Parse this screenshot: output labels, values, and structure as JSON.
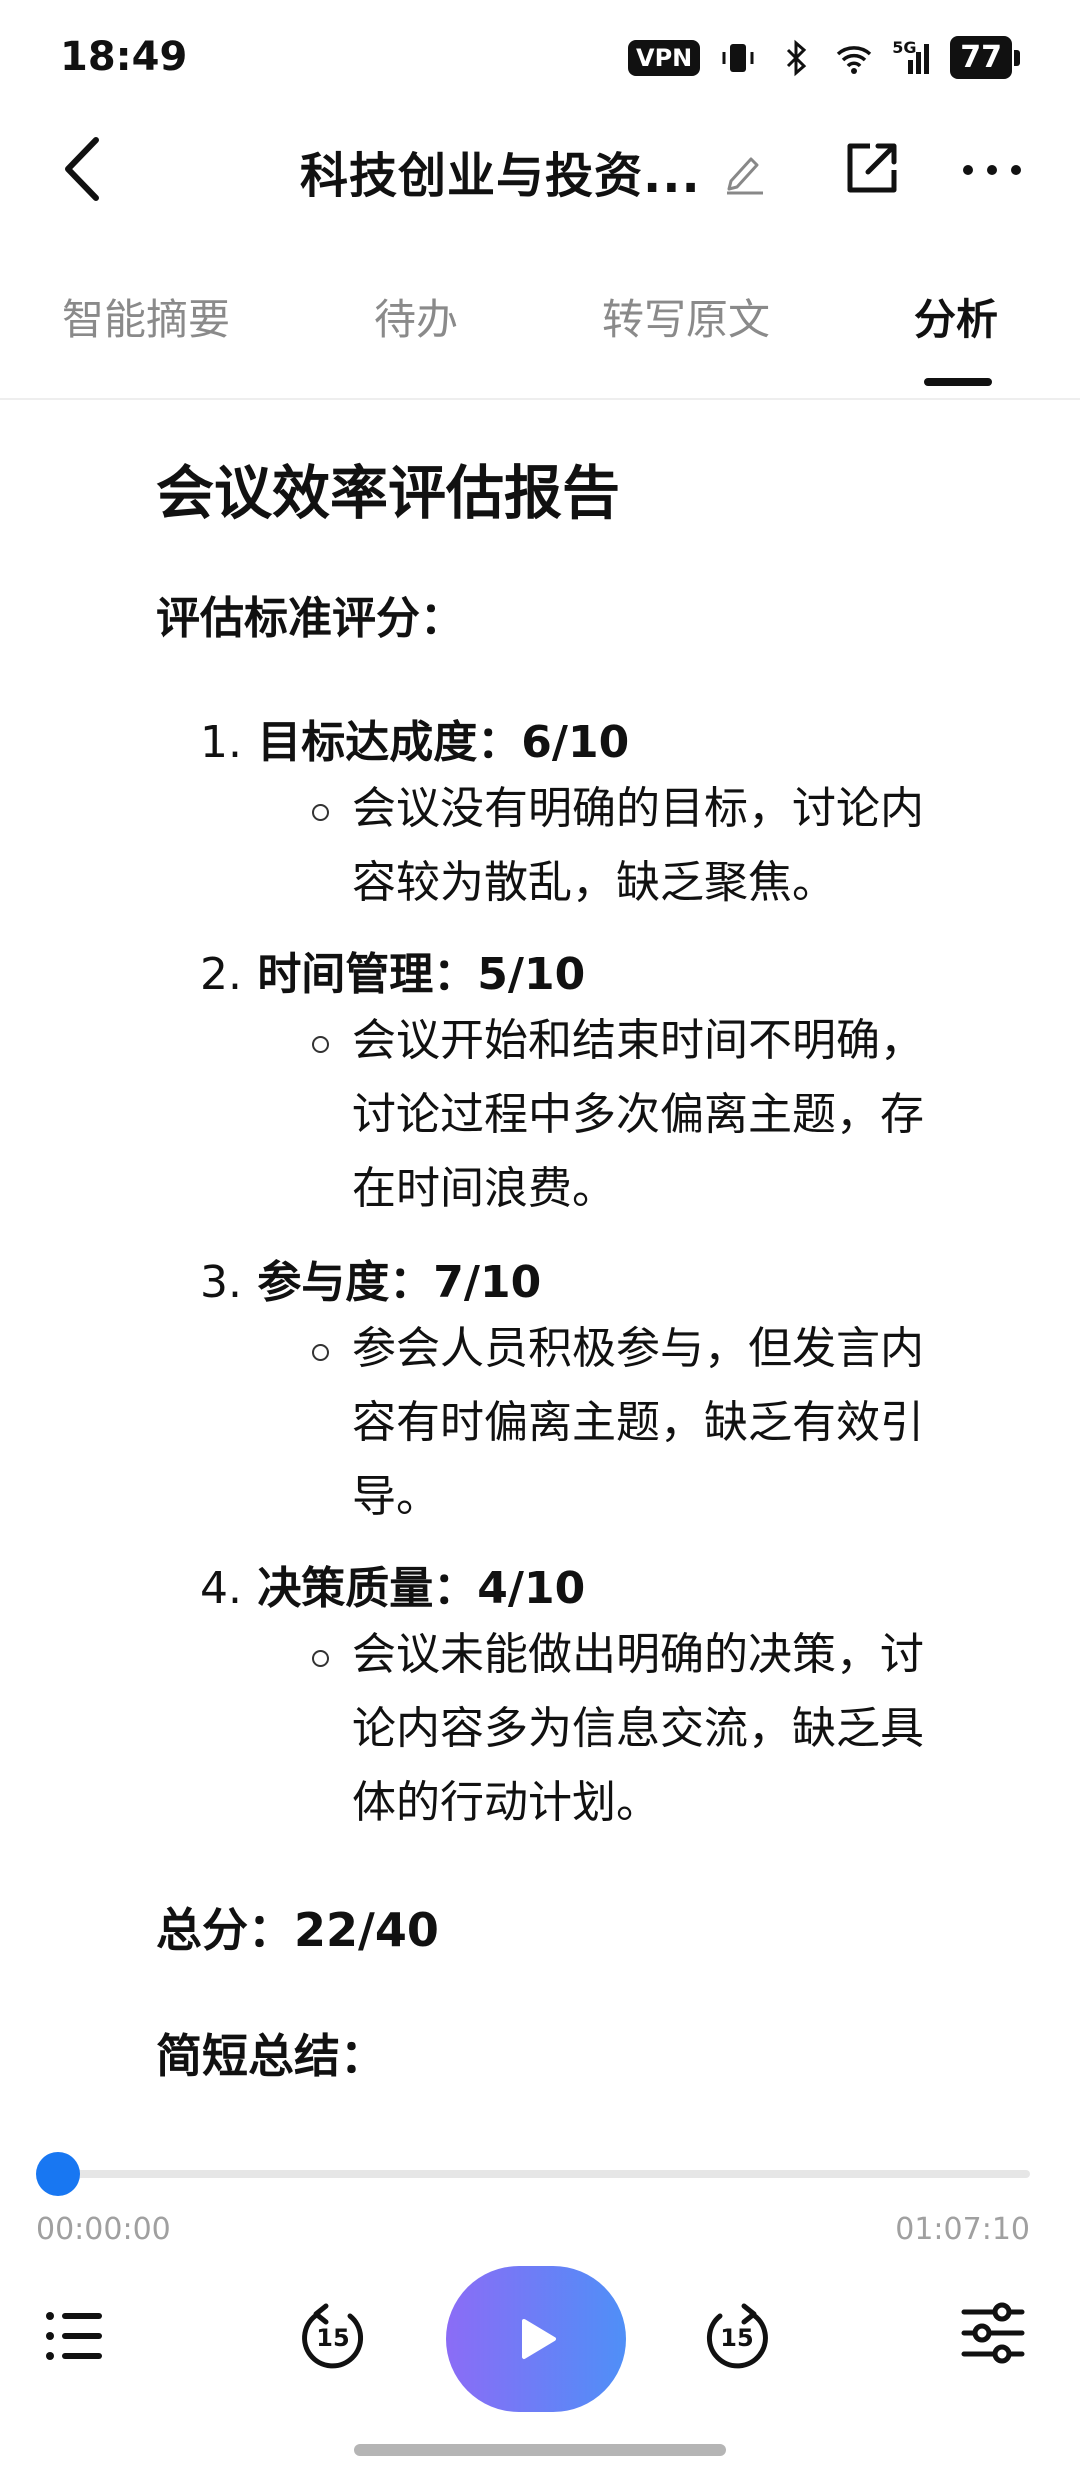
{
  "status_bar": {
    "time": "18:49",
    "vpn_label": "VPN",
    "network_label": "5G",
    "battery": "77"
  },
  "header": {
    "title": "科技创业与投资..."
  },
  "tabs": [
    {
      "label": "智能摘要",
      "active": false
    },
    {
      "label": "待办",
      "active": false
    },
    {
      "label": "转写原文",
      "active": false
    },
    {
      "label": "分析",
      "active": true
    }
  ],
  "report": {
    "title": "会议效率评估报告",
    "criteria_heading": "评估标准评分：",
    "items": [
      {
        "num": "1.",
        "title": "目标达成度：6/10",
        "lines": [
          "会议没有明确的目标，讨论内",
          "容较为散乱，缺乏聚焦。"
        ]
      },
      {
        "num": "2.",
        "title": "时间管理：5/10",
        "lines": [
          "会议开始和结束时间不明确，",
          "讨论过程中多次偏离主题，存",
          "在时间浪费。"
        ]
      },
      {
        "num": "3.",
        "title": "参与度：7/10",
        "lines": [
          "参会人员积极参与，但发言内",
          "容有时偏离主题，缺乏有效引",
          "导。"
        ]
      },
      {
        "num": "4.",
        "title": "决策质量：4/10",
        "lines": [
          "会议未能做出明确的决策，讨",
          "论内容多为信息交流，缺乏具",
          "体的行动计划。"
        ]
      }
    ],
    "total": "总分：22/40",
    "summary_heading": "简短总结："
  },
  "player": {
    "current_time": "00:00:00",
    "duration": "01:07:10",
    "progress": 0.0,
    "skip_back_label": "15",
    "skip_forward_label": "15",
    "accent_color": "#1877f2"
  }
}
